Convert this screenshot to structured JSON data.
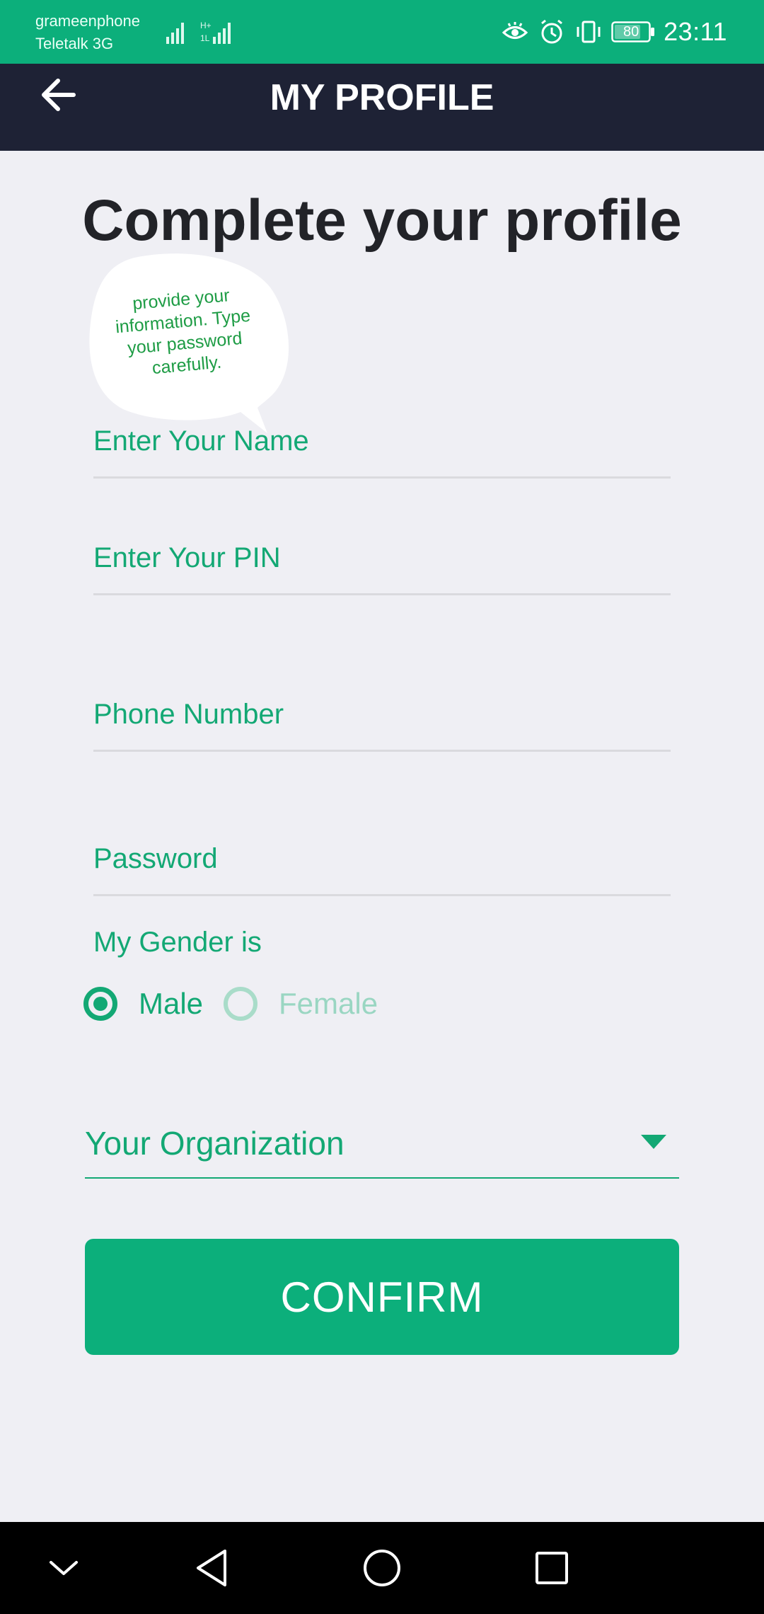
{
  "status_bar": {
    "carrier_1": "grameenphone",
    "carrier_2": "Teletalk 3G",
    "battery": "80",
    "time": "23:11"
  },
  "app_bar": {
    "title": "MY PROFILE"
  },
  "main": {
    "heading": "Complete your profile",
    "bubble_text": "provide your information. Type your password carefully.",
    "fields": {
      "name_placeholder": "Enter Your Name",
      "pin_placeholder": "Enter Your PIN",
      "phone_placeholder": "Phone Number",
      "password_placeholder": "Password"
    },
    "gender": {
      "label": "My Gender is",
      "options": [
        "Male",
        "Female"
      ],
      "selected": "Male"
    },
    "organization": {
      "placeholder": "Your Organization"
    },
    "confirm_label": "CONFIRM"
  },
  "colors": {
    "accent": "#0caf7b",
    "app_bar": "#1e2235",
    "background": "#efeff4"
  },
  "icons": {
    "back": "arrow-left-icon",
    "caret": "caret-down-icon",
    "nav": [
      "chevron-down-icon",
      "back-triangle-icon",
      "home-circle-icon",
      "recents-square-icon"
    ]
  }
}
